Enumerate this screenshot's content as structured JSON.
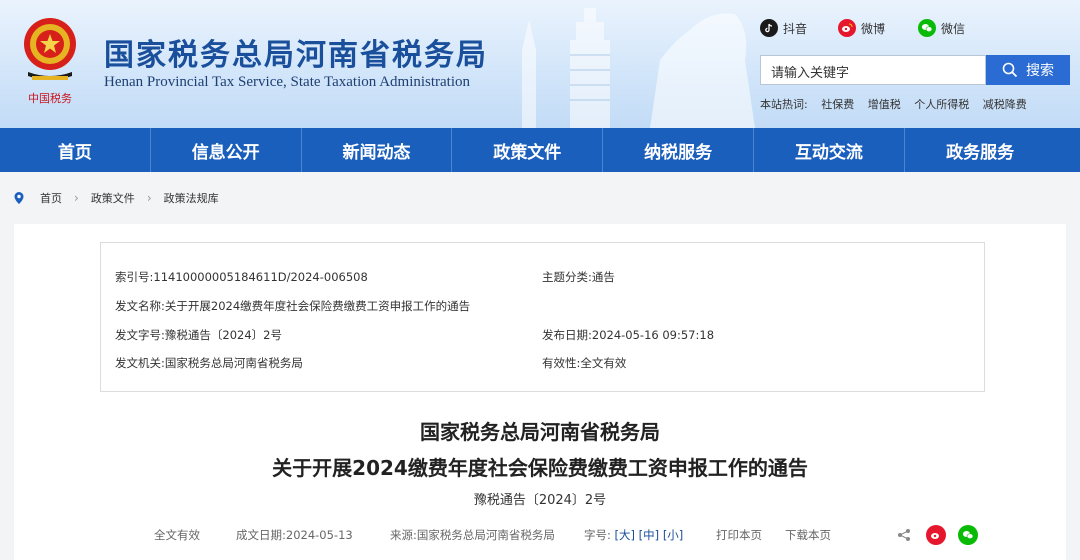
{
  "header": {
    "title": "国家税务总局河南省税务局",
    "subtitle": "Henan Provincial Tax Service, State Taxation Administration",
    "logo_text": "中国税务",
    "social": [
      {
        "label": "抖音",
        "icon": "douyin-icon"
      },
      {
        "label": "微博",
        "icon": "weibo-icon"
      },
      {
        "label": "微信",
        "icon": "wechat-icon"
      }
    ],
    "search_placeholder": "请输入关键字",
    "search_button": "搜索",
    "hot_label": "本站热词:",
    "hot_words": [
      "社保费",
      "增值税",
      "个人所得税",
      "减税降费"
    ]
  },
  "nav": [
    "首页",
    "信息公开",
    "新闻动态",
    "政策文件",
    "纳税服务",
    "互动交流",
    "政务服务"
  ],
  "breadcrumb": [
    "首页",
    "政策文件",
    "政策法规库"
  ],
  "meta": {
    "index_no": "索引号:11410000005184611D/2024-006508",
    "subject": "主题分类:通告",
    "doc_name": "发文名称:关于开展2024缴费年度社会保险费缴费工资申报工作的通告",
    "doc_no": "发文字号:豫税通告〔2024〕2号",
    "pub_date": "发布日期:2024-05-16 09:57:18",
    "issuer": "发文机关:国家税务总局河南省税务局",
    "validity": "有效性:全文有效"
  },
  "article": {
    "title_line1": "国家税务总局河南省税务局",
    "title_line2": "关于开展2024缴费年度社会保险费缴费工资申报工作的通告",
    "doc_number": "豫税通告〔2024〕2号"
  },
  "footer_bar": {
    "validity": "全文有效",
    "created": "成文日期:2024-05-13",
    "source": "来源:国家税务总局河南省税务局",
    "font_label": "字号:",
    "size_large": "[大]",
    "size_medium": "[中]",
    "size_small": "[小]",
    "print": "打印本页",
    "download": "下载本页"
  },
  "colors": {
    "nav_bg": "#1b5fbd",
    "title_blue": "#1a4f9c",
    "search_btn": "#2a6bd4",
    "weibo_red": "#e6162d",
    "wechat_green": "#09bb07"
  }
}
